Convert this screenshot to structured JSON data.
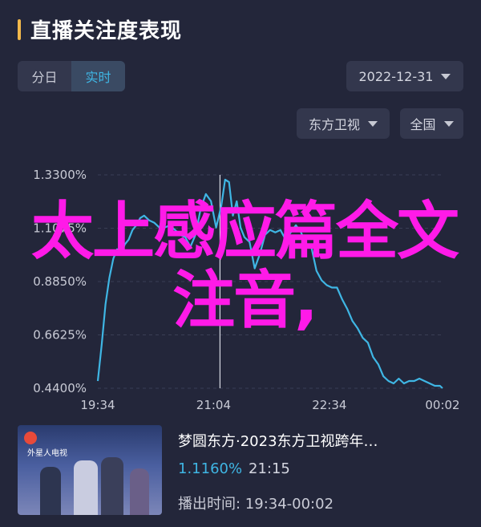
{
  "header": {
    "title": "直播关注度表现"
  },
  "tabs": [
    {
      "label": "分日",
      "active": false
    },
    {
      "label": "实时",
      "active": true
    }
  ],
  "filters": {
    "date": "2022-12-31",
    "channel": "东方卫视",
    "region": "全国"
  },
  "overlay_text": "太上感应篇全文注音,",
  "colors": {
    "background": "#23263a",
    "line": "#3fb6e4",
    "accent": "#f2b84b",
    "overlay": "#ff1ae8"
  },
  "chart_data": {
    "type": "line",
    "y_tick_labels": [
      "1.3300%",
      "1.1075%",
      "0.8850%",
      "0.6625%",
      "0.4400%"
    ],
    "y_ticks": [
      1.33,
      1.1075,
      0.885,
      0.6625,
      0.44
    ],
    "ylim": [
      0.44,
      1.33
    ],
    "x_tick_labels": [
      "19:34",
      "21:04",
      "22:34",
      "00:02"
    ],
    "x_ticks": [
      0,
      90,
      180,
      268
    ],
    "xlim": [
      0,
      268
    ],
    "cursor_x": 95,
    "series": [
      {
        "x": [
          0,
          3,
          6,
          9,
          12,
          15,
          18,
          21,
          24,
          27,
          30,
          33,
          36,
          40,
          44,
          48,
          52,
          56,
          60,
          64,
          68,
          72,
          76,
          80,
          84,
          88,
          92,
          96,
          99,
          102,
          105,
          108,
          111,
          114,
          118,
          122,
          126,
          130,
          134,
          138,
          142,
          146,
          150,
          154,
          158,
          162,
          166,
          170,
          174,
          178,
          182,
          186,
          190,
          194,
          198,
          202,
          206,
          210,
          214,
          218,
          222,
          226,
          230,
          234,
          238,
          242,
          246,
          250,
          254,
          258,
          262,
          266,
          268
        ],
        "y": [
          0.47,
          0.62,
          0.79,
          0.9,
          0.98,
          1.02,
          1.0,
          1.04,
          1.06,
          1.1,
          1.12,
          1.15,
          1.16,
          1.14,
          1.13,
          1.11,
          1.11,
          1.12,
          1.1,
          1.08,
          1.07,
          1.03,
          1.08,
          1.19,
          1.25,
          1.22,
          1.11,
          1.2,
          1.31,
          1.3,
          1.16,
          1.22,
          1.11,
          1.07,
          1.05,
          0.94,
          1.0,
          1.08,
          1.1,
          1.09,
          1.1,
          1.06,
          1.09,
          1.12,
          1.09,
          1.04,
          1.03,
          0.93,
          0.89,
          0.87,
          0.86,
          0.86,
          0.81,
          0.77,
          0.72,
          0.69,
          0.65,
          0.63,
          0.57,
          0.54,
          0.49,
          0.47,
          0.46,
          0.48,
          0.46,
          0.47,
          0.47,
          0.48,
          0.47,
          0.46,
          0.45,
          0.45,
          0.44
        ]
      }
    ]
  },
  "card": {
    "title": "梦圆东方·2023东方卫视跨年…",
    "rating": "1.1160%",
    "time": "21:15",
    "airtime": "播出时间: 19:34-00:02",
    "thumb_caption": "外星人电视"
  }
}
